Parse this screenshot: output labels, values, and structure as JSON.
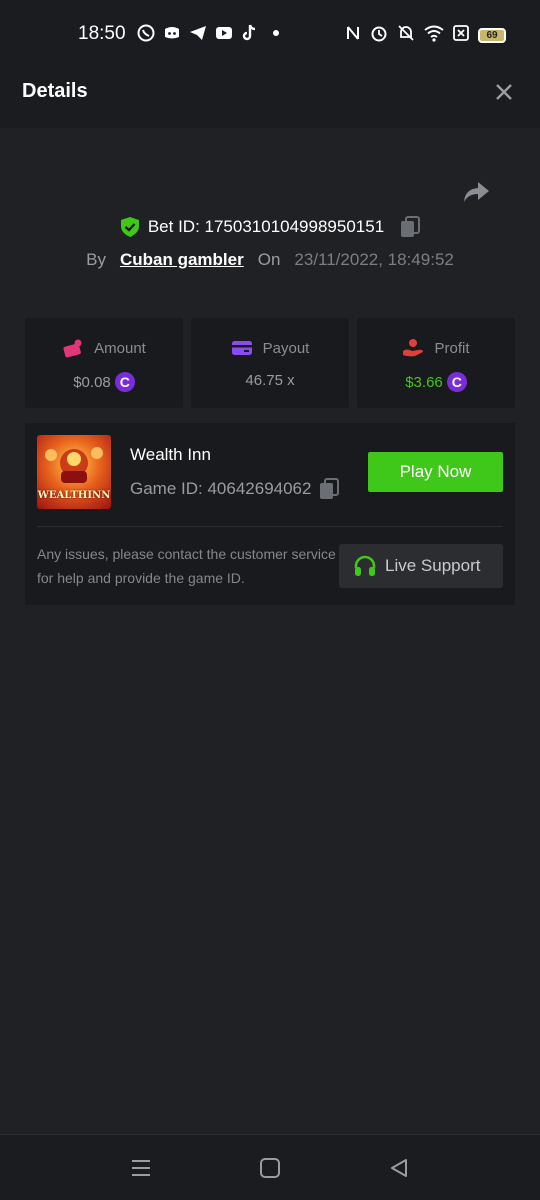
{
  "status_bar": {
    "time": "18:50",
    "app_icons": [
      "whatsapp-icon",
      "discord-icon",
      "telegram-icon",
      "youtube-icon",
      "tiktok-icon",
      "dot-icon"
    ],
    "system_icons": [
      "nfc-icon",
      "alarm-icon",
      "mute-icon",
      "wifi-icon",
      "sim-off-icon"
    ],
    "battery": "69"
  },
  "header": {
    "title": "Details"
  },
  "bet": {
    "id_label": "Bet ID: 1750310104998950151",
    "by_label": "By",
    "user": "Cuban gambler",
    "on_label": "On",
    "datetime": "23/11/2022, 18:49:52"
  },
  "stats": {
    "amount": {
      "label": "Amount",
      "value": "$0.08",
      "coin": "C"
    },
    "payout": {
      "label": "Payout",
      "value": "46.75 x"
    },
    "profit": {
      "label": "Profit",
      "value": "$3.66",
      "coin": "C"
    }
  },
  "game": {
    "name": "Wealth Inn",
    "thumb_text": "WEALTHINN",
    "id_label": "Game ID: 40642694062",
    "play_label": "Play Now",
    "support_text": "Any issues, please contact the customer service for help and provide the game ID.",
    "support_label": "Live Support"
  },
  "colors": {
    "accent_green": "#3fc71a",
    "coin_purple": "#7b2cd9",
    "shield_green": "#3fc71a",
    "amount_icon": "#e2357a",
    "payout_icon": "#8a4cf0",
    "profit_icon": "#e0403a"
  }
}
